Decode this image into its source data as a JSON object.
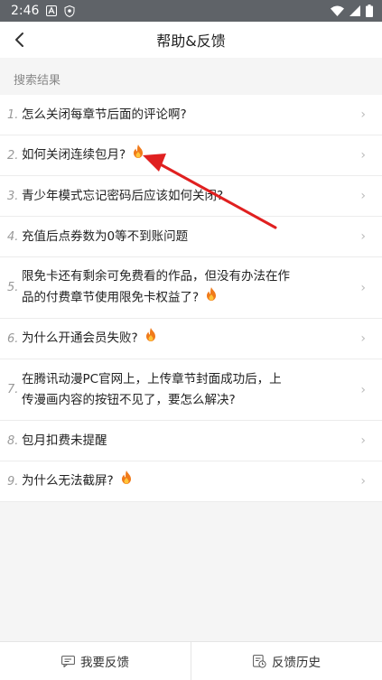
{
  "status_bar": {
    "time": "2:46"
  },
  "header": {
    "title": "帮助&反馈"
  },
  "section": {
    "label": "搜索结果"
  },
  "questions": [
    {
      "num": "1.",
      "text": "怎么关闭每章节后面的评论啊?",
      "hot": false
    },
    {
      "num": "2.",
      "text": "如何关闭连续包月?",
      "hot": true
    },
    {
      "num": "3.",
      "text": "青少年模式忘记密码后应该如何关闭?",
      "hot": false
    },
    {
      "num": "4.",
      "text": "充值后点券数为0等不到账问题",
      "hot": false
    },
    {
      "num": "5.",
      "text": "限免卡还有剩余可免费看的作品，但没有办法在作品的付费章节使用限免卡权益了?",
      "hot": true
    },
    {
      "num": "6.",
      "text": "为什么开通会员失败?",
      "hot": true
    },
    {
      "num": "7.",
      "text": "在腾讯动漫PC官网上，上传章节封面成功后，上传漫画内容的按钮不见了，要怎么解决?",
      "hot": false
    },
    {
      "num": "8.",
      "text": "包月扣费未提醒",
      "hot": false
    },
    {
      "num": "9.",
      "text": "为什么无法截屏?",
      "hot": true
    }
  ],
  "footer": {
    "feedback_label": "我要反馈",
    "history_label": "反馈历史"
  },
  "colors": {
    "annotation_arrow": "#e02020",
    "fire": "#f07a1a"
  }
}
